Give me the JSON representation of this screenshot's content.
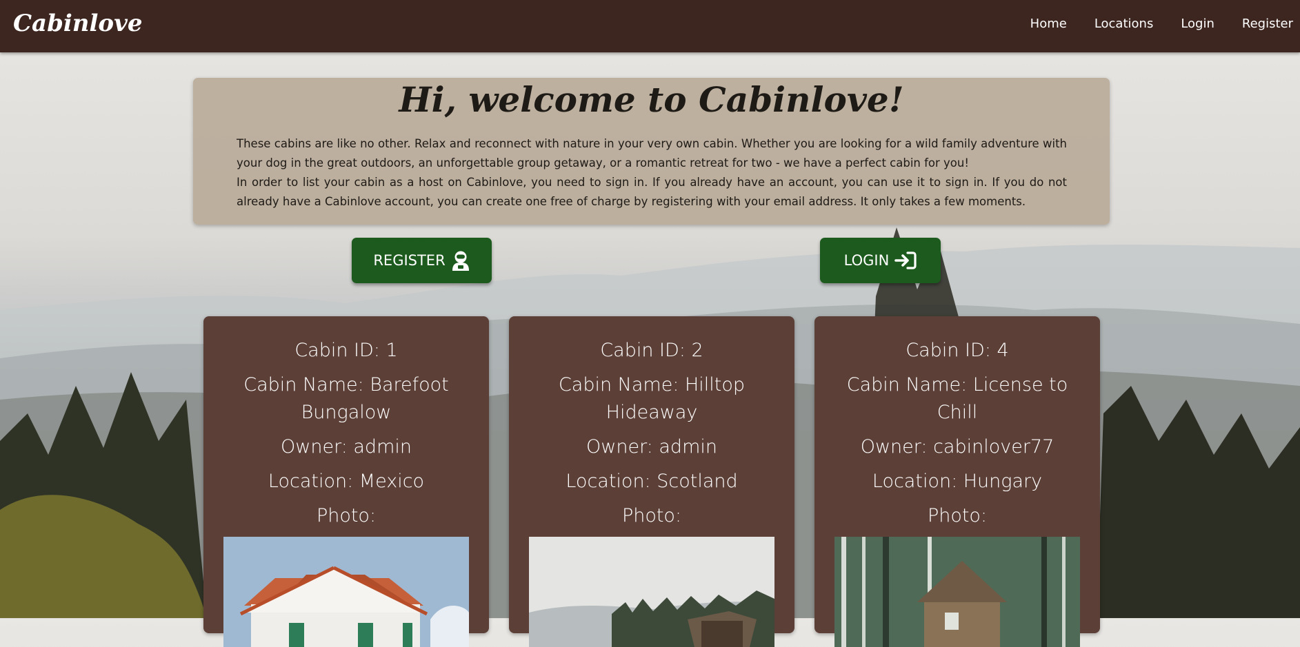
{
  "brand": "Cabinlove",
  "nav": {
    "home": "Home",
    "locations": "Locations",
    "login": "Login",
    "register": "Register"
  },
  "welcome": {
    "title": "Hi, welcome to Cabinlove!",
    "paragraph1": "These cabins are like no other. Relax and reconnect with nature in your very own cabin. Whether you are looking for a wild family adventure with your dog in the great outdoors, an unforgettable group getaway, or a romantic retreat for two - we have a perfect cabin for you!",
    "paragraph2": "In order to list your cabin as a host on Cabinlove, you need to sign in. If you already have an account, you can use it to sign in. If you do not already have a Cabinlove account, you can create one free of charge by registering with your email address. It only takes a few moments."
  },
  "buttons": {
    "register": "REGISTER",
    "login": "LOGIN"
  },
  "colors": {
    "navbar": "#3d2620",
    "button": "#1c5a1d",
    "card": "#5c3f36"
  },
  "cabins": [
    {
      "id": "Cabin ID: 1",
      "name": "Cabin Name: Barefoot Bungalow",
      "owner": "Owner: admin",
      "location": "Location: Mexico",
      "photo_label": "Photo:"
    },
    {
      "id": "Cabin ID: 2",
      "name": "Cabin Name: Hilltop Hideaway",
      "owner": "Owner: admin",
      "location": "Location: Scotland",
      "photo_label": "Photo:"
    },
    {
      "id": "Cabin ID: 4",
      "name": "Cabin Name: License to Chill",
      "owner": "Owner: cabinlover77",
      "location": "Location: Hungary",
      "photo_label": "Photo:"
    }
  ]
}
